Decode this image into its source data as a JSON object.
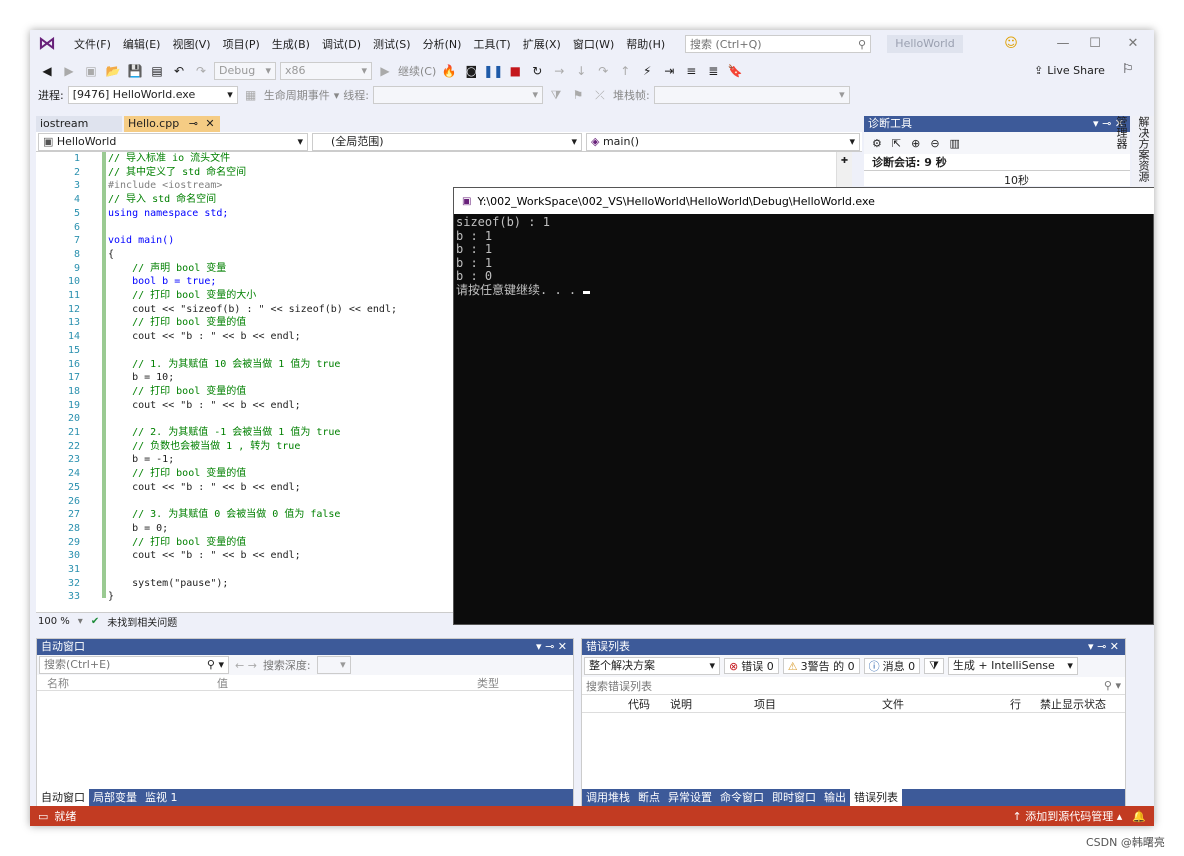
{
  "menu": [
    "文件(F)",
    "编辑(E)",
    "视图(V)",
    "项目(P)",
    "生成(B)",
    "调试(D)",
    "测试(S)",
    "分析(N)",
    "工具(T)",
    "扩展(X)",
    "窗口(W)",
    "帮助(H)"
  ],
  "search_placeholder": "搜索 (Ctrl+Q)",
  "project_title": "HelloWorld",
  "live_share": "Live Share",
  "toolbar": {
    "config": "Debug",
    "platform": "x86",
    "continue": "继续(C)"
  },
  "toolbar2": {
    "process_label": "进程:",
    "process_value": "[9476] HelloWorld.exe",
    "lifecycle": "生命周期事件",
    "thread": "线程:",
    "stack_frame": "堆栈帧:"
  },
  "tabs": [
    "iostream",
    "Hello.cpp"
  ],
  "editor_nav": {
    "project": "HelloWorld",
    "scope": "(全局范围)",
    "function": "main()"
  },
  "code_lines": [
    "// 导入标准 io 流头文件",
    "// 其中定义了 std 命名空间",
    "#include <iostream>",
    "// 导入 std 命名空间",
    "using namespace std;",
    "",
    "void main()",
    "{",
    "    // 声明 bool 变量",
    "    bool b = true;",
    "    // 打印 bool 变量的大小",
    "    cout << \"sizeof(b) : \" << sizeof(b) << endl;",
    "    // 打印 bool 变量的值",
    "    cout << \"b : \" << b << endl;",
    "",
    "    // 1. 为其赋值 10 会被当做 1 值为 true",
    "    b = 10;",
    "    // 打印 bool 变量的值",
    "    cout << \"b : \" << b << endl;",
    "",
    "    // 2. 为其赋值 -1 会被当做 1 值为 true",
    "    // 负数也会被当做 1 , 转为 true",
    "    b = -1;",
    "    // 打印 bool 变量的值",
    "    cout << \"b : \" << b << endl;",
    "",
    "    // 3. 为其赋值 0 会被当做 0 值为 false",
    "    b = 0;",
    "    // 打印 bool 变量的值",
    "    cout << \"b : \" << b << endl;",
    "",
    "    system(\"pause\");",
    "}"
  ],
  "editor_status": {
    "zoom": "100 %",
    "issues": "未找到相关问题"
  },
  "console": {
    "title": "Y:\\002_WorkSpace\\002_VS\\HelloWorld\\HelloWorld\\Debug\\HelloWorld.exe",
    "lines": [
      "sizeof(b) : 1",
      "b : 1",
      "b : 1",
      "b : 1",
      "b : 0",
      "请按任意键继续. . . "
    ]
  },
  "diag": {
    "title": "诊断工具",
    "session": "诊断会话: 9 秒",
    "time_label": "10秒",
    "vertical_tab": "解决方案资源管理器"
  },
  "autos": {
    "title": "自动窗口",
    "search_placeholder": "搜索(Ctrl+E)",
    "search_depth": "搜索深度:",
    "columns": [
      "名称",
      "值",
      "类型"
    ],
    "tabs": [
      "自动窗口",
      "局部变量",
      "监视 1"
    ]
  },
  "errors": {
    "title": "错误列表",
    "scope": "整个解决方案",
    "errors_label": "错误 0",
    "warnings_label": "3警告 的 0",
    "messages_label": "消息 0",
    "build_filter": "生成 + IntelliSense",
    "search_placeholder": "搜索错误列表",
    "columns": [
      "代码",
      "说明",
      "项目",
      "文件",
      "行",
      "禁止显示状态"
    ],
    "tabs": [
      "调用堆栈",
      "断点",
      "异常设置",
      "命令窗口",
      "即时窗口",
      "输出",
      "错误列表"
    ]
  },
  "status": {
    "ready": "就绪",
    "source_control": "添加到源代码管理"
  },
  "watermark": "CSDN @韩曙亮"
}
